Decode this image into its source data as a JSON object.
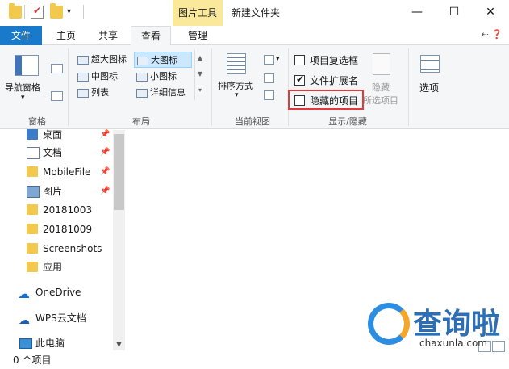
{
  "titlebar": {
    "context_tab": "图片工具",
    "window_title": "新建文件夹",
    "minimize": "—",
    "maximize": "☐",
    "close": "✕"
  },
  "tabs": [
    {
      "label": "文件"
    },
    {
      "label": "主页"
    },
    {
      "label": "共享"
    },
    {
      "label": "查看"
    },
    {
      "label": "管理"
    }
  ],
  "ribbon_help": "⇠ ❓",
  "ribbon": {
    "pane_group": {
      "label": "窗格",
      "nav_pane": "导航窗格"
    },
    "layout_group": {
      "label": "布局",
      "options": [
        "超大图标",
        "大图标",
        "中图标",
        "小图标",
        "列表",
        "详细信息"
      ],
      "selected": "大图标"
    },
    "current_view_group": {
      "label": "当前视图",
      "sort_by": "排序方式"
    },
    "show_hide_group": {
      "label": "显示/隐藏",
      "item_checkboxes": "项目复选框",
      "file_extensions": "文件扩展名",
      "hidden_items": "隐藏的项目",
      "hide_selected_line1": "隐藏",
      "hide_selected_line2": "所选项目"
    },
    "options": "选项"
  },
  "nav": {
    "items": [
      {
        "label": "桌面",
        "icon": "desktop-icon",
        "pinned": true
      },
      {
        "label": "文档",
        "icon": "document-icon",
        "pinned": true
      },
      {
        "label": "MobileFile",
        "icon": "folder-icon",
        "pinned": true
      },
      {
        "label": "图片",
        "icon": "pictures-icon",
        "pinned": true
      },
      {
        "label": "20181003",
        "icon": "folder-icon",
        "pinned": false
      },
      {
        "label": "20181009",
        "icon": "folder-icon",
        "pinned": false
      },
      {
        "label": "Screenshots",
        "icon": "folder-icon",
        "pinned": false
      },
      {
        "label": "应用",
        "icon": "folder-icon",
        "pinned": false
      }
    ],
    "onedrive": "OneDrive",
    "wps": "WPS云文档",
    "this_pc": "此电脑"
  },
  "status": {
    "text": "0 个项目"
  },
  "watermark": {
    "text": "查询啦",
    "domain": "chaxunla.com"
  },
  "colors": {
    "accent": "#1979ca",
    "highlight": "#e03a3a"
  }
}
